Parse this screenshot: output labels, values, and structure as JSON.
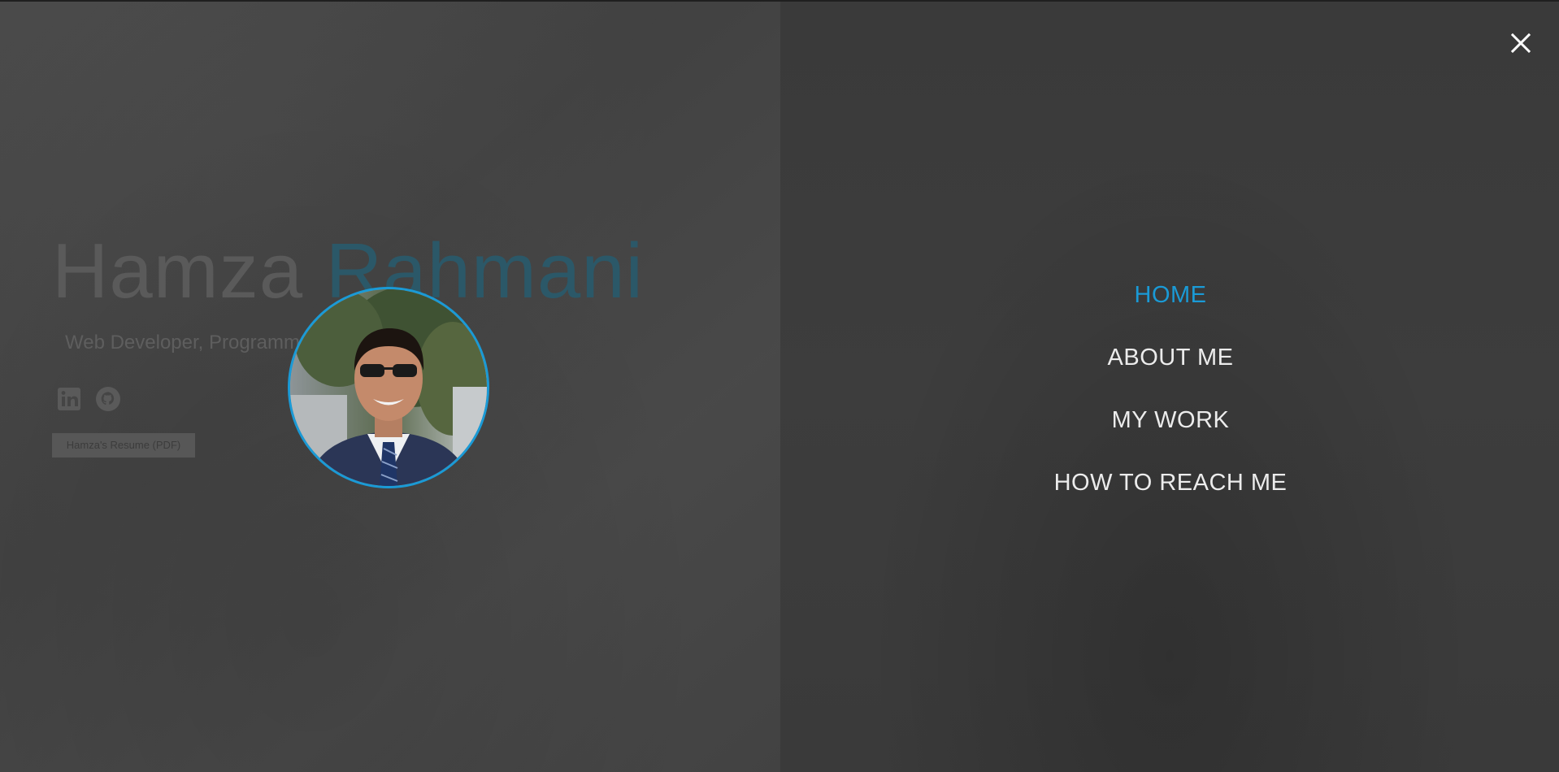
{
  "hero": {
    "first_name": "Hamza",
    "last_name": "Rahmani",
    "subtitle": "Web Developer, Programmer, Designer",
    "resume_label": "Hamza's Resume (PDF)",
    "social_icons": [
      "linkedin-icon",
      "github-icon"
    ]
  },
  "overlay_menu": {
    "items": [
      {
        "label": "HOME",
        "active": true
      },
      {
        "label": "ABOUT ME",
        "active": false
      },
      {
        "label": "MY WORK",
        "active": false
      },
      {
        "label": "HOW TO REACH ME",
        "active": false
      }
    ],
    "close_icon": "close-icon"
  },
  "colors": {
    "accent": "#1a9ad6",
    "overlay_left": "#454545",
    "overlay_right": "#3c3c3c",
    "menu_text": "#ececec"
  }
}
